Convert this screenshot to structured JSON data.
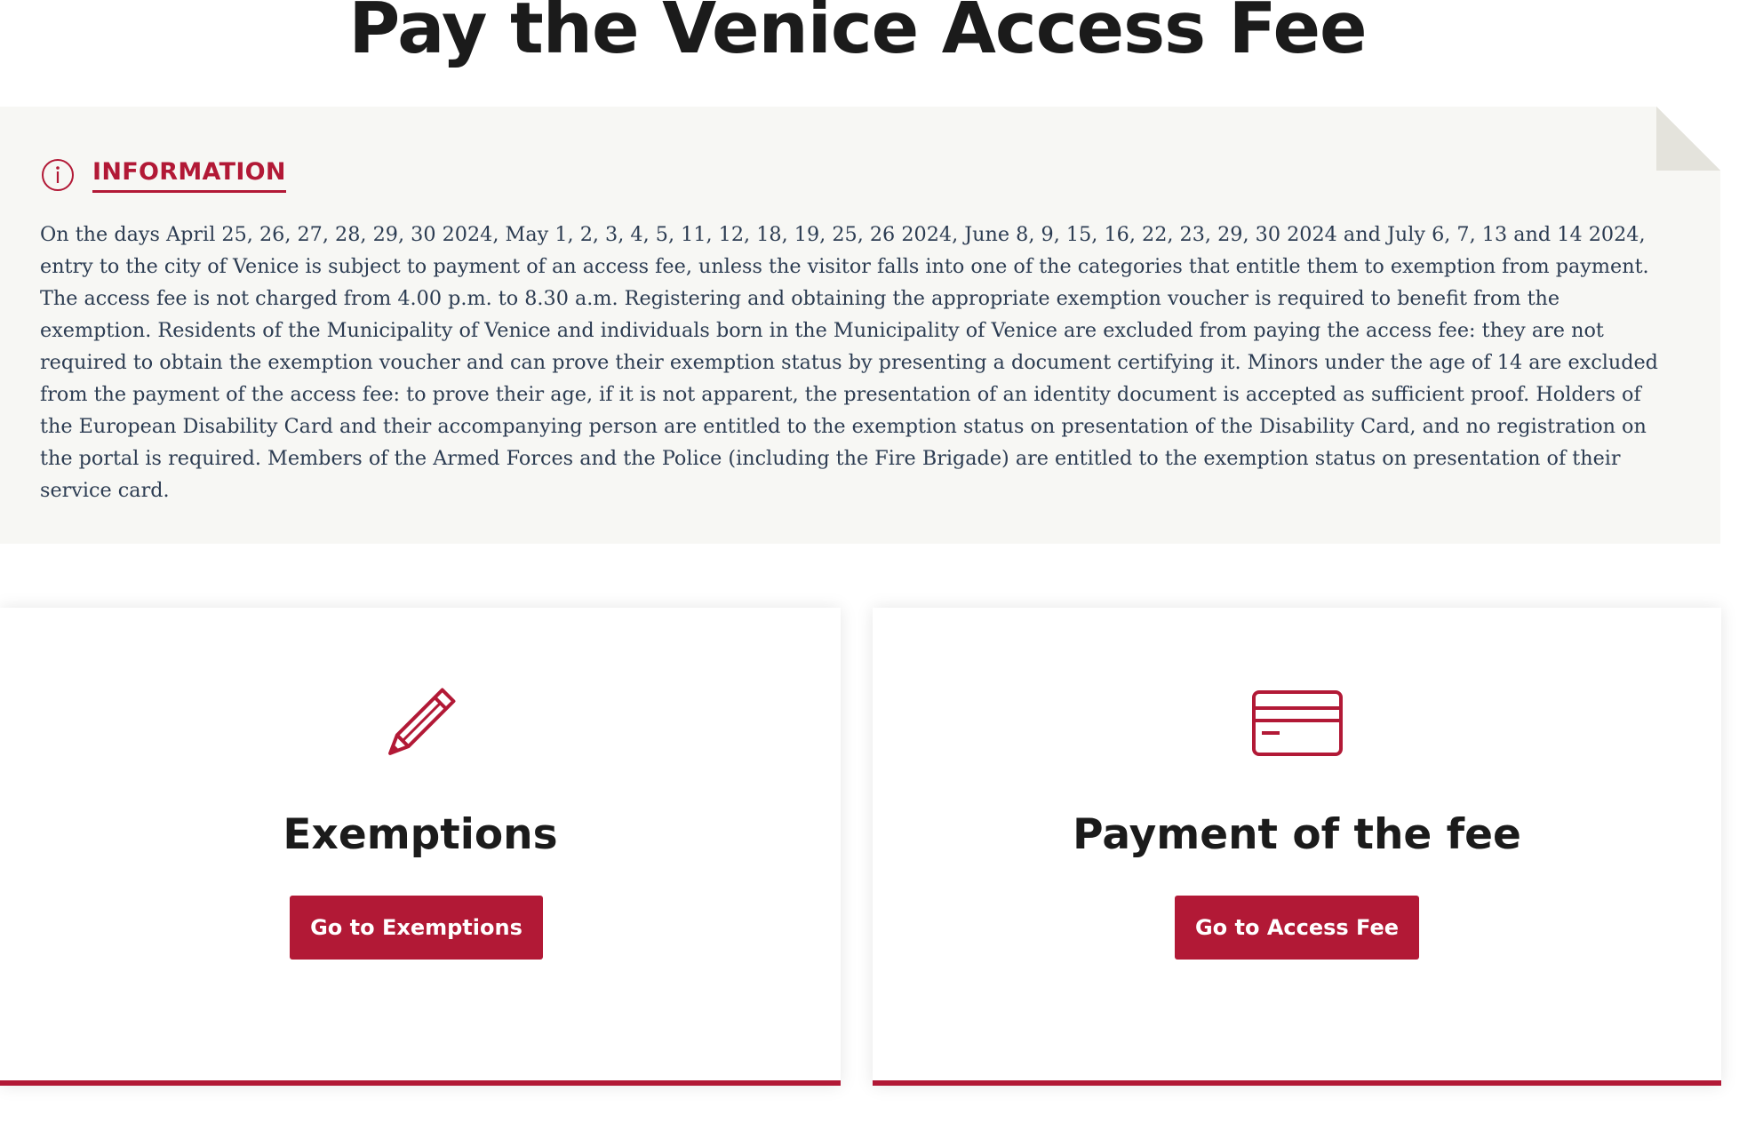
{
  "page": {
    "title": "Pay the Venice Access Fee"
  },
  "info": {
    "heading": "INFORMATION",
    "icon": "info-circle-icon",
    "text": "On the days April 25, 26, 27, 28, 29, 30 2024, May 1, 2, 3, 4, 5, 11, 12, 18, 19, 25, 26 2024, June 8, 9, 15, 16, 22, 23, 29, 30 2024 and July 6, 7, 13 and 14 2024, entry to the city of Venice is subject to payment of an access fee, unless the visitor falls into one of the categories that entitle them to exemption from payment. The access fee is not charged from 4.00 p.m. to 8.30 a.m. Registering and obtaining the appropriate exemption voucher is required to benefit from the exemption. Residents of the Municipality of Venice and individuals born in the Municipality of Venice are excluded from paying the access fee: they are not required to obtain the exemption voucher and can prove their exemption status by presenting a document certifying it. Minors under the age of 14 are excluded from the payment of the access fee: to prove their age, if it is not apparent, the presentation of an identity document is accepted as sufficient proof. Holders of the European Disability Card and their accompanying person are entitled to the exemption status on presentation of the Disability Card, and no registration on the portal is required. Members of the Armed Forces and the Police (including the Fire Brigade) are entitled to the exemption status on presentation of their service card."
  },
  "cards": [
    {
      "icon": "pencil-icon",
      "title": "Exemptions",
      "button_label": "Go to Exemptions"
    },
    {
      "icon": "credit-card-icon",
      "title": "Payment of the fee",
      "button_label": "Go to Access Fee"
    }
  ],
  "colors": {
    "accent": "#b21936",
    "info_background": "#f7f7f4",
    "body_text": "#2c3c52",
    "heading_text": "#1b1b1b"
  }
}
